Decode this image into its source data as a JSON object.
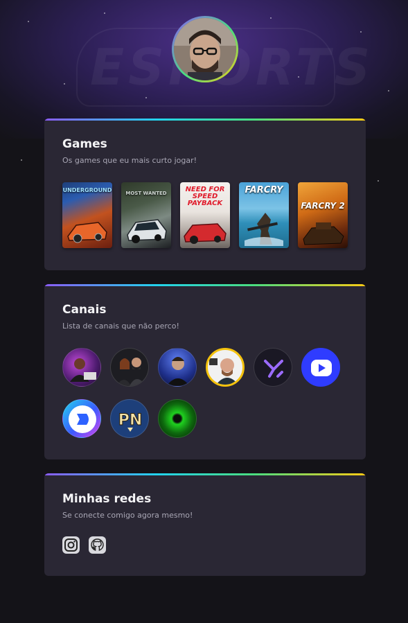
{
  "profile": {
    "avatar_icon": "profile-photo"
  },
  "sections": {
    "games": {
      "title": "Games",
      "subtitle": "Os games que eu mais curto jogar!",
      "items": [
        {
          "label": "UNDERGROUND"
        },
        {
          "label": "MOST WANTED"
        },
        {
          "label": "NEED FOR SPEED PAYBACK"
        },
        {
          "label": "FARCRY"
        },
        {
          "label": "FARCRY 2"
        }
      ]
    },
    "channels": {
      "title": "Canais",
      "subtitle": "Lista de canais que não perco!"
    },
    "social": {
      "title": "Minhas redes",
      "subtitle": "Se conecte comigo agora mesmo!"
    }
  },
  "colors": {
    "background": "#141318",
    "card": "#2a2734",
    "gradient": [
      "#8b5cf6",
      "#22d3ee",
      "#4ade80",
      "#facc15"
    ]
  }
}
